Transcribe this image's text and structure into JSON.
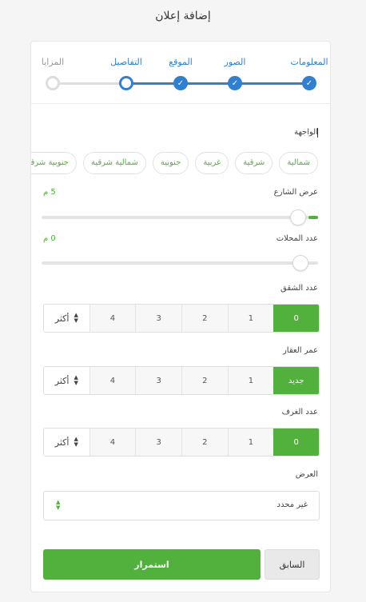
{
  "page": {
    "title": "إضافة إعلان"
  },
  "steps": [
    {
      "label": "المعلومات",
      "status": "done"
    },
    {
      "label": "الصور",
      "status": "done"
    },
    {
      "label": "الموقع",
      "status": "done"
    },
    {
      "label": "التفاصيل",
      "status": "current"
    },
    {
      "label": "المزايا",
      "status": "todo"
    }
  ],
  "check_glyph": "✓",
  "facade": {
    "label": "الواجهة",
    "options": [
      "شمالية",
      "شرقية",
      "غربية",
      "جنوبية",
      "شمالية شرقية",
      "جنوبية شرقية"
    ]
  },
  "street_width": {
    "label": "عرض الشارع",
    "value_text": "5 م",
    "fraction": 0.99
  },
  "shops": {
    "label": "عدد المحلات",
    "value_text": "0 م",
    "fraction": 0.0
  },
  "apartments": {
    "label": "عدد الشقق",
    "options": [
      "0",
      "1",
      "2",
      "3",
      "4"
    ],
    "selected": "0",
    "more_label": "أكثر"
  },
  "property_age": {
    "label": "عمر العقار",
    "options": [
      "جديد",
      "1",
      "2",
      "3",
      "4"
    ],
    "selected": "جديد",
    "more_label": "أكثر"
  },
  "rooms": {
    "label": "عدد الغرف",
    "options": [
      "0",
      "1",
      "2",
      "3",
      "4"
    ],
    "selected": "0",
    "more_label": "أكثر"
  },
  "width_select": {
    "label": "العرض",
    "value": "غير محدد"
  },
  "buttons": {
    "continue": "استمرار",
    "previous": "السابق"
  },
  "colors": {
    "primary_blue": "#2f80d1",
    "accent_green": "#52b13d"
  }
}
